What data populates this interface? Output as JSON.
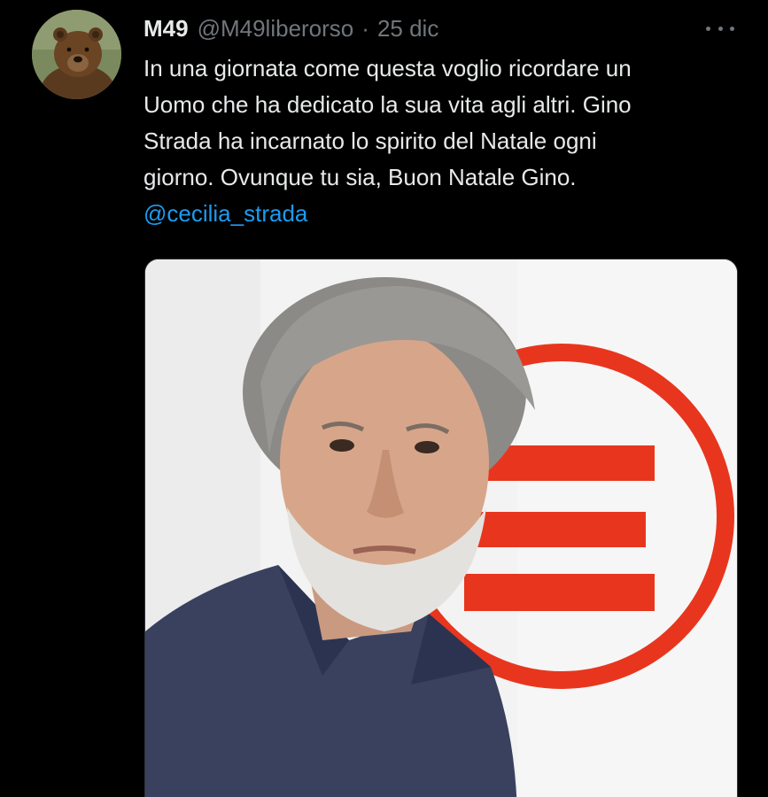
{
  "tweet": {
    "display_name": "M49",
    "handle": "@M49liberorso",
    "separator": "·",
    "date": "25 dic",
    "text_lines": [
      "In una giornata come questa voglio ricordare un",
      "Uomo che ha dedicato la sua vita agli altri. Gino",
      "Strada ha incarnato lo spirito del Natale ogni",
      "giorno. Ovunque tu sia, Buon Natale Gino."
    ],
    "mention": "@cecilia_strada",
    "avatar_icon": "bear-avatar",
    "more_icon": "more-options-icon",
    "media_icon": "photo-man-with-emergency-logo"
  },
  "colors": {
    "background": "#000000",
    "text": "#e7e9ea",
    "secondary": "#71767b",
    "link": "#1d9bf0",
    "logo_red": "#e8361e"
  }
}
